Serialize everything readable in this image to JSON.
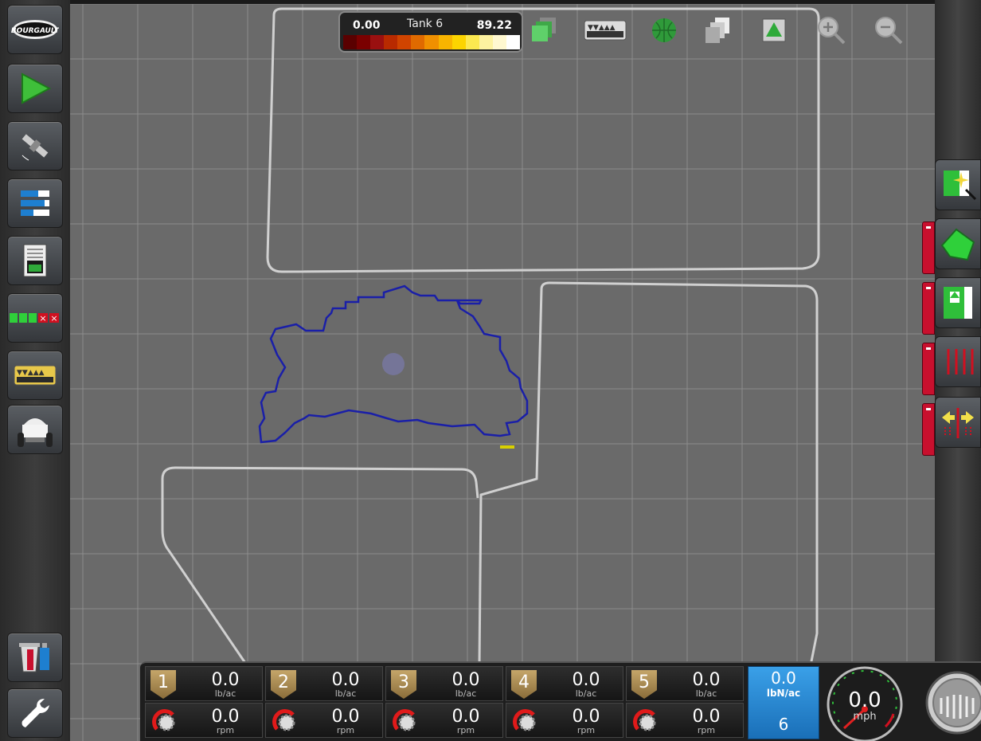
{
  "colors": {
    "map": "#6a6a6a",
    "boundary": "#1a1fa8",
    "accent_red": "#c8102e",
    "blue_panel": "#2a87d2"
  },
  "logo": {
    "text": "BOURGAULT"
  },
  "legend": {
    "min": "0.00",
    "name": "Tank 6",
    "max": "89.22",
    "colors": [
      "#5a0000",
      "#7a0000",
      "#9a1010",
      "#b82a00",
      "#d04400",
      "#e06a00",
      "#f09000",
      "#f8b400",
      "#fcd400",
      "#fce850",
      "#fdf2a0",
      "#fff8d0",
      "#ffffff"
    ]
  },
  "toolbar": {
    "icons": [
      "layers-icon",
      "tank-config-icon",
      "globe-icon",
      "stack-icon",
      "field-grid-icon",
      "zoom-in-icon",
      "zoom-out-icon"
    ]
  },
  "left_buttons": [
    "bourgault-logo-button",
    "guidance-button",
    "gps-button",
    "product-status-button",
    "report-button",
    "section-control-button",
    "tank-control-button",
    "tractor-button",
    "usb-export-button",
    "settings-button"
  ],
  "sections": [
    {
      "num": "1",
      "rate": "0.0",
      "rate_unit": "lb/ac",
      "speed": "0.0",
      "speed_unit": "rpm"
    },
    {
      "num": "2",
      "rate": "0.0",
      "rate_unit": "lb/ac",
      "speed": "0.0",
      "speed_unit": "rpm"
    },
    {
      "num": "3",
      "rate": "0.0",
      "rate_unit": "lb/ac",
      "speed": "0.0",
      "speed_unit": "rpm"
    },
    {
      "num": "4",
      "rate": "0.0",
      "rate_unit": "lb/ac",
      "speed": "0.0",
      "speed_unit": "rpm"
    },
    {
      "num": "5",
      "rate": "0.0",
      "rate_unit": "lb/ac",
      "speed": "0.0",
      "speed_unit": "rpm"
    }
  ],
  "tank6": {
    "rate": "0.0",
    "unit": "lbN/ac",
    "num": "6"
  },
  "speed": {
    "value": "0.0",
    "unit": "mph"
  }
}
